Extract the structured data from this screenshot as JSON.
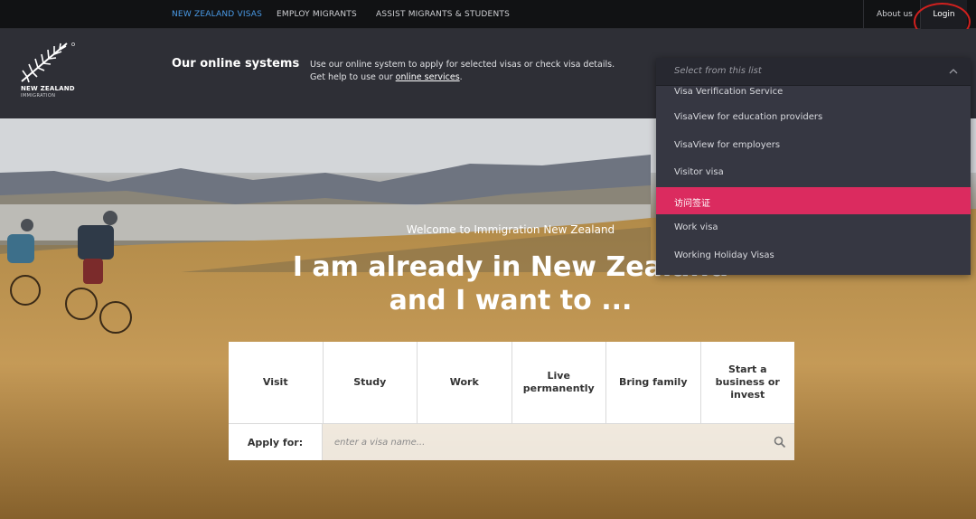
{
  "topnav": {
    "links": [
      "NEW ZEALAND VISAS",
      "EMPLOY MIGRANTS",
      "ASSIST MIGRANTS & STUDENTS"
    ],
    "about": "About us",
    "login": "Login"
  },
  "logo": {
    "name": "NEW ZEALAND",
    "sub": "IMMIGRATION"
  },
  "systems": {
    "title": "Our online systems",
    "desc": "Use our online system to apply for selected visas or check visa details. Get help to use our ",
    "link": "online services",
    "desc_end": "."
  },
  "dropdown": {
    "placeholder": "Select from this list",
    "items": [
      "Visa Verification Service",
      "VisaView for education providers",
      "VisaView for employers",
      "Visitor visa",
      "访问签证",
      "Work visa",
      "Working Holiday Visas"
    ],
    "highlighted_index": 4
  },
  "hero": {
    "welcome": "Welcome to Immigration New Zealand",
    "headline_1": "I am already in New Zealand",
    "headline_2": "and I want to ..."
  },
  "cards": [
    "Visit",
    "Study",
    "Work",
    "Live permanently",
    "Bring family",
    "Start a business or invest"
  ],
  "apply": {
    "label": "Apply for:",
    "placeholder": "enter a visa name..."
  },
  "colors": {
    "nav_bg": "#111214",
    "header_bg": "#2e2f36",
    "active_link": "#4a9be8",
    "highlight": "#db2b5f",
    "dropdown_bg": "#363742"
  }
}
